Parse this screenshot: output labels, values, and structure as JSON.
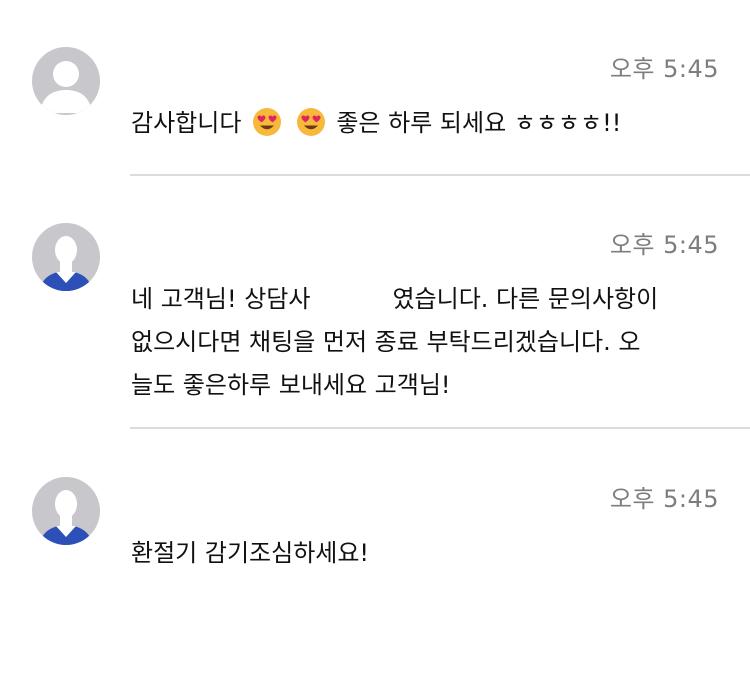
{
  "messages": [
    {
      "avatar": "default-user-icon",
      "time": "오후 5:45",
      "text_before_emoji": "감사합니다",
      "emoji": "heart-eyes-emoji",
      "text_after_emoji": "좋은 하루 되세요 ㅎㅎㅎㅎ!!"
    },
    {
      "avatar": "agent-silhouette-icon",
      "time": "오후 5:45",
      "line1_start": "네 고객님! 상담사",
      "line1_end": "였습니다. 다른 문의사항이",
      "line2": "없으시다면 채팅을 먼저 종료 부탁드리겠습니다. 오",
      "line3": "늘도 좋은하루 보내세요 고객님!"
    },
    {
      "avatar": "agent-silhouette-icon",
      "time": "오후 5:45",
      "text": "환절기 감기조심하세요!"
    }
  ],
  "colors": {
    "time": "#7d7d7d",
    "divider": "#dcdcdc",
    "avatar_bg": "#c7c7cc",
    "agent_shirt": "#2c4fb8"
  }
}
